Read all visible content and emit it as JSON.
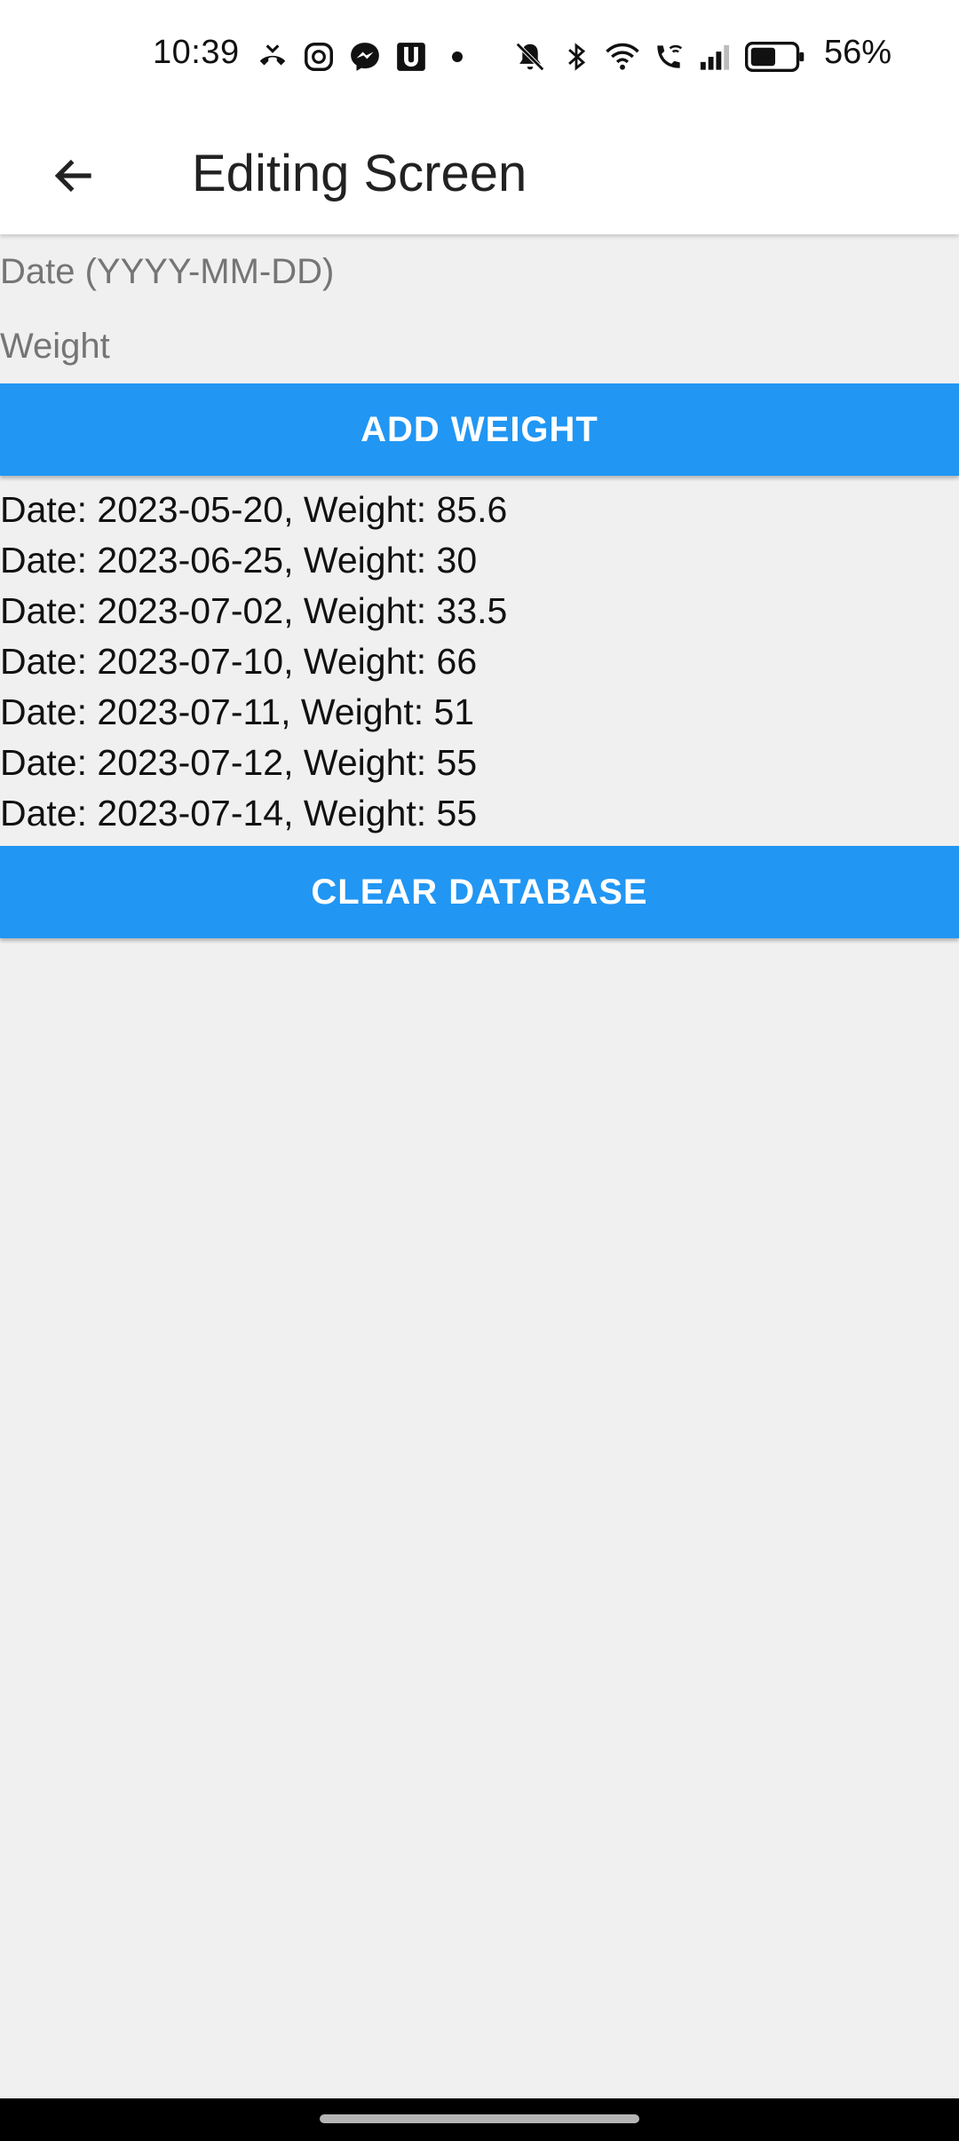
{
  "status_bar": {
    "time": "10:39",
    "battery_percent": "56%",
    "left_icons": [
      "missed-call-icon",
      "messenger-alt-icon",
      "messenger-icon",
      "u-app-icon",
      "notification-dot-icon"
    ],
    "right_icons": [
      "mute-icon",
      "bluetooth-icon",
      "wifi-icon",
      "wifi-calling-icon",
      "signal-icon",
      "battery-icon"
    ]
  },
  "app_bar": {
    "title": "Editing Screen",
    "back_icon": "arrow-left-icon"
  },
  "form": {
    "date_placeholder": "Date (YYYY-MM-DD)",
    "date_value": "",
    "weight_placeholder": "Weight",
    "weight_value": "",
    "add_button_label": "ADD WEIGHT"
  },
  "weights": [
    "Date: 2023-05-20, Weight: 85.6",
    "Date: 2023-06-25, Weight: 30",
    "Date: 2023-07-02, Weight: 33.5",
    "Date: 2023-07-10, Weight: 66",
    "Date: 2023-07-11, Weight: 51",
    "Date: 2023-07-12, Weight: 55",
    "Date: 2023-07-14, Weight: 55"
  ],
  "clear_button_label": "CLEAR DATABASE",
  "colors": {
    "accent": "#2196f3",
    "background": "#f0f0f0",
    "app_bar": "#ffffff"
  }
}
